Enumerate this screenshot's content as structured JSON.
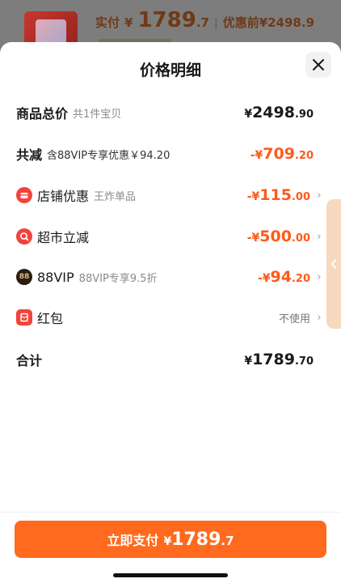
{
  "background": {
    "price_label": "实付",
    "price_yen": "¥",
    "price_big": "1789",
    "price_small": ".7",
    "separator": "|",
    "orig_label": "优惠前¥2498.9"
  },
  "sheet": {
    "title": "价格明细",
    "close_icon": "close-icon"
  },
  "rows": {
    "total": {
      "label": "商品总价",
      "sub": "共1件宝贝",
      "yen": "¥",
      "int": "2498",
      "dec": ".90"
    },
    "discount": {
      "label": "共减",
      "sub": "含88VIP专享优惠￥94.20",
      "yen": "-¥",
      "int": "709",
      "dec": ".20"
    },
    "shop": {
      "label": "店铺优惠",
      "sub": "王炸单品",
      "yen": "-¥",
      "int": "115",
      "dec": ".00",
      "icon": "shop-icon"
    },
    "market": {
      "label": "超市立减",
      "sub": "",
      "yen": "-¥",
      "int": "500",
      "dec": ".00",
      "icon": "supermarket-icon"
    },
    "vip": {
      "label": "88VIP",
      "sub": "88VIP专享9.5折",
      "yen": "-¥",
      "int": "94",
      "dec": ".20",
      "icon": "88vip-icon",
      "icon_text": "88"
    },
    "redpacket": {
      "label": "红包",
      "value": "不使用",
      "icon": "red-packet-icon"
    },
    "sum": {
      "label": "合计",
      "yen": "¥",
      "int": "1789",
      "dec": ".70"
    }
  },
  "pay": {
    "label": "立即支付",
    "yen": "¥",
    "int": "1789",
    "dec": ".7"
  },
  "colors": {
    "accent": "#ff6a1f",
    "discount_text": "#ff5a1a",
    "icon_red": "#f2433b"
  }
}
